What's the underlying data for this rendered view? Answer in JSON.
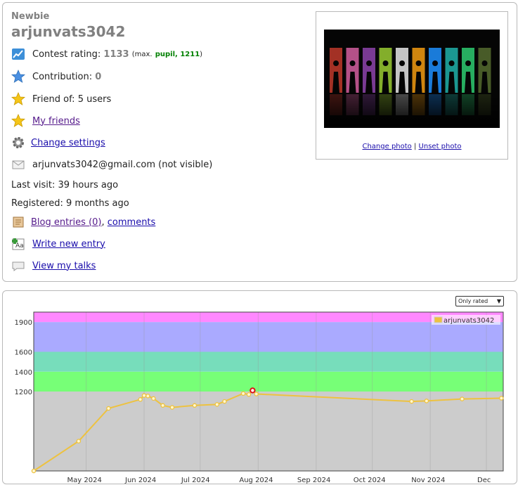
{
  "profile": {
    "rank": "Newbie",
    "handle": "arjunvats3042",
    "contest_rating_label": "Contest rating:",
    "contest_rating_value": "1133",
    "max_prefix": "(max.",
    "max_title": "pupil, 1211",
    "max_suffix": ")",
    "contribution_label": "Contribution:",
    "contribution_value": "0",
    "friend_of": "Friend of: 5 users",
    "my_friends": "My friends",
    "change_settings": "Change settings",
    "email": "arjunvats3042@gmail.com (not visible)",
    "last_visit": "Last visit: 39 hours ago",
    "registered": "Registered: 9 months ago",
    "blog_entries": "Blog entries (0)",
    "blog_sep": ",",
    "comments": "comments",
    "write_new_entry": "Write new entry",
    "view_talks": "View my talks",
    "change_photo": "Change photo",
    "photo_sep": "|",
    "unset_photo": "Unset photo"
  },
  "icons": {
    "rating": "rating-chart-icon",
    "contribution": "star-blue-icon",
    "friend": "star-gold-icon",
    "my_friends": "star-gold-icon",
    "settings": "gear-icon",
    "email": "envelope-icon",
    "blog": "blog-notes-icon",
    "write": "write-entry-icon",
    "talks": "chat-bubble-icon"
  },
  "filter": {
    "selected": "Only rated"
  },
  "colors": {
    "newbie": "#808080",
    "pupil": "#008000",
    "link": "#1a0dab",
    "band_gray": "#cccccc",
    "band_green": "#77ff77",
    "band_teal": "#77ddbb",
    "band_blue": "#aaaaff",
    "band_pink": "#ff88ff",
    "line": "#edc240"
  },
  "chart_data": {
    "type": "line",
    "legend": "arjunvats3042",
    "legend_position": "top-right",
    "y_ticks": [
      1200,
      1400,
      1600,
      1900
    ],
    "x_ticks": [
      "May 2024",
      "Jun 2024",
      "Jul 2024",
      "Aug 2024",
      "Sep 2024",
      "Oct 2024",
      "Nov 2024",
      "Dec"
    ],
    "x_range": [
      "2024-04-03",
      "2024-12-10"
    ],
    "y_range": [
      400,
      2000
    ],
    "bands": [
      {
        "from": 0,
        "to": 1200,
        "color": "#cccccc"
      },
      {
        "from": 1200,
        "to": 1400,
        "color": "#77ff77"
      },
      {
        "from": 1400,
        "to": 1600,
        "color": "#77ddbb"
      },
      {
        "from": 1600,
        "to": 1900,
        "color": "#aaaaff"
      },
      {
        "from": 1900,
        "to": 2100,
        "color": "#ff88ff"
      }
    ],
    "points": [
      {
        "x": "2024-04-03",
        "y": 400
      },
      {
        "x": "2024-04-27",
        "y": 700
      },
      {
        "x": "2024-05-13",
        "y": 1030
      },
      {
        "x": "2024-05-30",
        "y": 1120
      },
      {
        "x": "2024-06-01",
        "y": 1160
      },
      {
        "x": "2024-06-03",
        "y": 1155
      },
      {
        "x": "2024-06-06",
        "y": 1130
      },
      {
        "x": "2024-06-11",
        "y": 1060
      },
      {
        "x": "2024-06-16",
        "y": 1040
      },
      {
        "x": "2024-06-28",
        "y": 1060
      },
      {
        "x": "2024-07-10",
        "y": 1070
      },
      {
        "x": "2024-07-14",
        "y": 1100
      },
      {
        "x": "2024-07-24",
        "y": 1180
      },
      {
        "x": "2024-07-27",
        "y": 1170
      },
      {
        "x": "2024-07-29",
        "y": 1211
      },
      {
        "x": "2024-07-31",
        "y": 1175
      },
      {
        "x": "2024-10-22",
        "y": 1100
      },
      {
        "x": "2024-10-30",
        "y": 1105
      },
      {
        "x": "2024-11-18",
        "y": 1125
      },
      {
        "x": "2024-12-09",
        "y": 1133
      }
    ],
    "highlight_index": 14
  }
}
